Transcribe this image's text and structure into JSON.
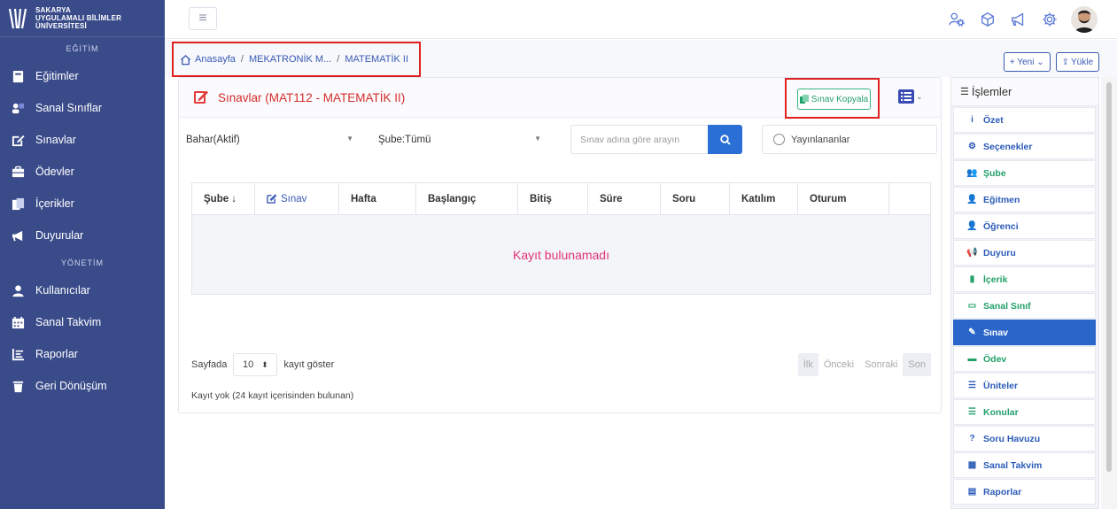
{
  "sidebar": {
    "logo_lines": [
      "SAKARYA",
      "UYGULAMALI BİLİMLER",
      "ÜNİVERSİTESİ"
    ],
    "section_education": "EĞİTİM",
    "section_management": "YÖNETİM",
    "education_items": [
      {
        "label": "Eğitimler",
        "icon": "book-icon"
      },
      {
        "label": "Sanal Sınıflar",
        "icon": "virtual-class-icon"
      },
      {
        "label": "Sınavlar",
        "icon": "edit-icon"
      },
      {
        "label": "Ödevler",
        "icon": "briefcase-icon"
      },
      {
        "label": "İçerikler",
        "icon": "copy-icon"
      },
      {
        "label": "Duyurular",
        "icon": "megaphone-icon"
      }
    ],
    "management_items": [
      {
        "label": "Kullanıcılar",
        "icon": "user-icon"
      },
      {
        "label": "Sanal Takvim",
        "icon": "calendar-icon"
      },
      {
        "label": "Raporlar",
        "icon": "report-icon"
      },
      {
        "label": "Geri Dönüşüm",
        "icon": "trash-icon"
      }
    ]
  },
  "topbar": {
    "menu_icon": "≡"
  },
  "breadcrumb": {
    "home": "Anasayfa",
    "course": "MEKATRONİK M...",
    "current": "MATEMATİK II",
    "separator": "/"
  },
  "actions": {
    "new_label": "+ Yeni ⌄",
    "upload_label": "Yükle"
  },
  "card": {
    "title": "Sınavlar (MAT112 - MATEMATİK II)",
    "copy_exam_label": "Sınav Kopyala"
  },
  "filters": {
    "term": "Bahar(Aktif)",
    "branch": "Şube:Tümü",
    "search_placeholder": "Sınav adına göre arayın",
    "published_label": "Yayınlananlar"
  },
  "table": {
    "columns": [
      "Şube ↓",
      "Sınav",
      "Hafta",
      "Başlangıç",
      "Bitiş",
      "Süre",
      "Soru",
      "Katılım",
      "Oturum",
      ""
    ],
    "empty_message": "Kayıt bulunamadı"
  },
  "pagination": {
    "per_page_prefix": "Sayfada",
    "per_page_value": "10",
    "per_page_suffix": "kayıt göster",
    "first": "İlk",
    "prev": "Önceki",
    "next": "Sonraki",
    "last": "Son",
    "record_info": "Kayıt yok (24 kayıt içerisinden bulunan)"
  },
  "right_panel": {
    "header": "İşlemler",
    "items": [
      {
        "label": "Özet",
        "icon": "i",
        "color": "blue"
      },
      {
        "label": "Seçenekler",
        "icon": "⚙",
        "color": "blue"
      },
      {
        "label": "Şube",
        "icon": "👥",
        "color": "green"
      },
      {
        "label": "Eğitmen",
        "icon": "👤",
        "color": "blue"
      },
      {
        "label": "Öğrenci",
        "icon": "👤",
        "color": "blue"
      },
      {
        "label": "Duyuru",
        "icon": "📢",
        "color": "blue"
      },
      {
        "label": "İçerik",
        "icon": "▮",
        "color": "green"
      },
      {
        "label": "Sanal Sınıf",
        "icon": "▭",
        "color": "green"
      },
      {
        "label": "Sınav",
        "icon": "✎",
        "color": "active"
      },
      {
        "label": "Ödev",
        "icon": "▬",
        "color": "green"
      },
      {
        "label": "Üniteler",
        "icon": "☰",
        "color": "blue"
      },
      {
        "label": "Konular",
        "icon": "☰",
        "color": "green"
      },
      {
        "label": "Soru Havuzu",
        "icon": "?",
        "color": "blue"
      },
      {
        "label": "Sanal Takvim",
        "icon": "▦",
        "color": "blue"
      },
      {
        "label": "Raporlar",
        "icon": "▤",
        "color": "blue"
      }
    ]
  },
  "colors": {
    "sidebar_bg": "#3a4b8a",
    "accent_blue": "#2a66c9",
    "title_red": "#d42b2b",
    "highlight_red": "#e02020",
    "success_green": "#23a06a",
    "empty_pink": "#e0337a"
  }
}
